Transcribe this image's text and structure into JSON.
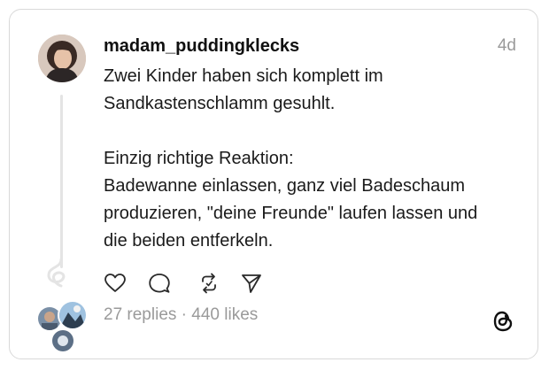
{
  "post": {
    "username": "madam_puddingklecks",
    "time": "4d",
    "text": "Zwei Kinder haben sich komplett im\nSandkastenschlamm gesuhlt.\n\nEinzig richtige Reaktion:\nBadewanne einlassen, ganz viel Badeschaum\nproduzieren, \"deine Freunde\" laufen lassen und\ndie beiden entferkeln."
  },
  "stats": {
    "text": "27 replies · 440 likes"
  },
  "icons": {
    "like": "heart-icon",
    "reply": "comment-icon",
    "repost": "repost-icon",
    "share": "send-icon",
    "brand": "threads-logo"
  }
}
